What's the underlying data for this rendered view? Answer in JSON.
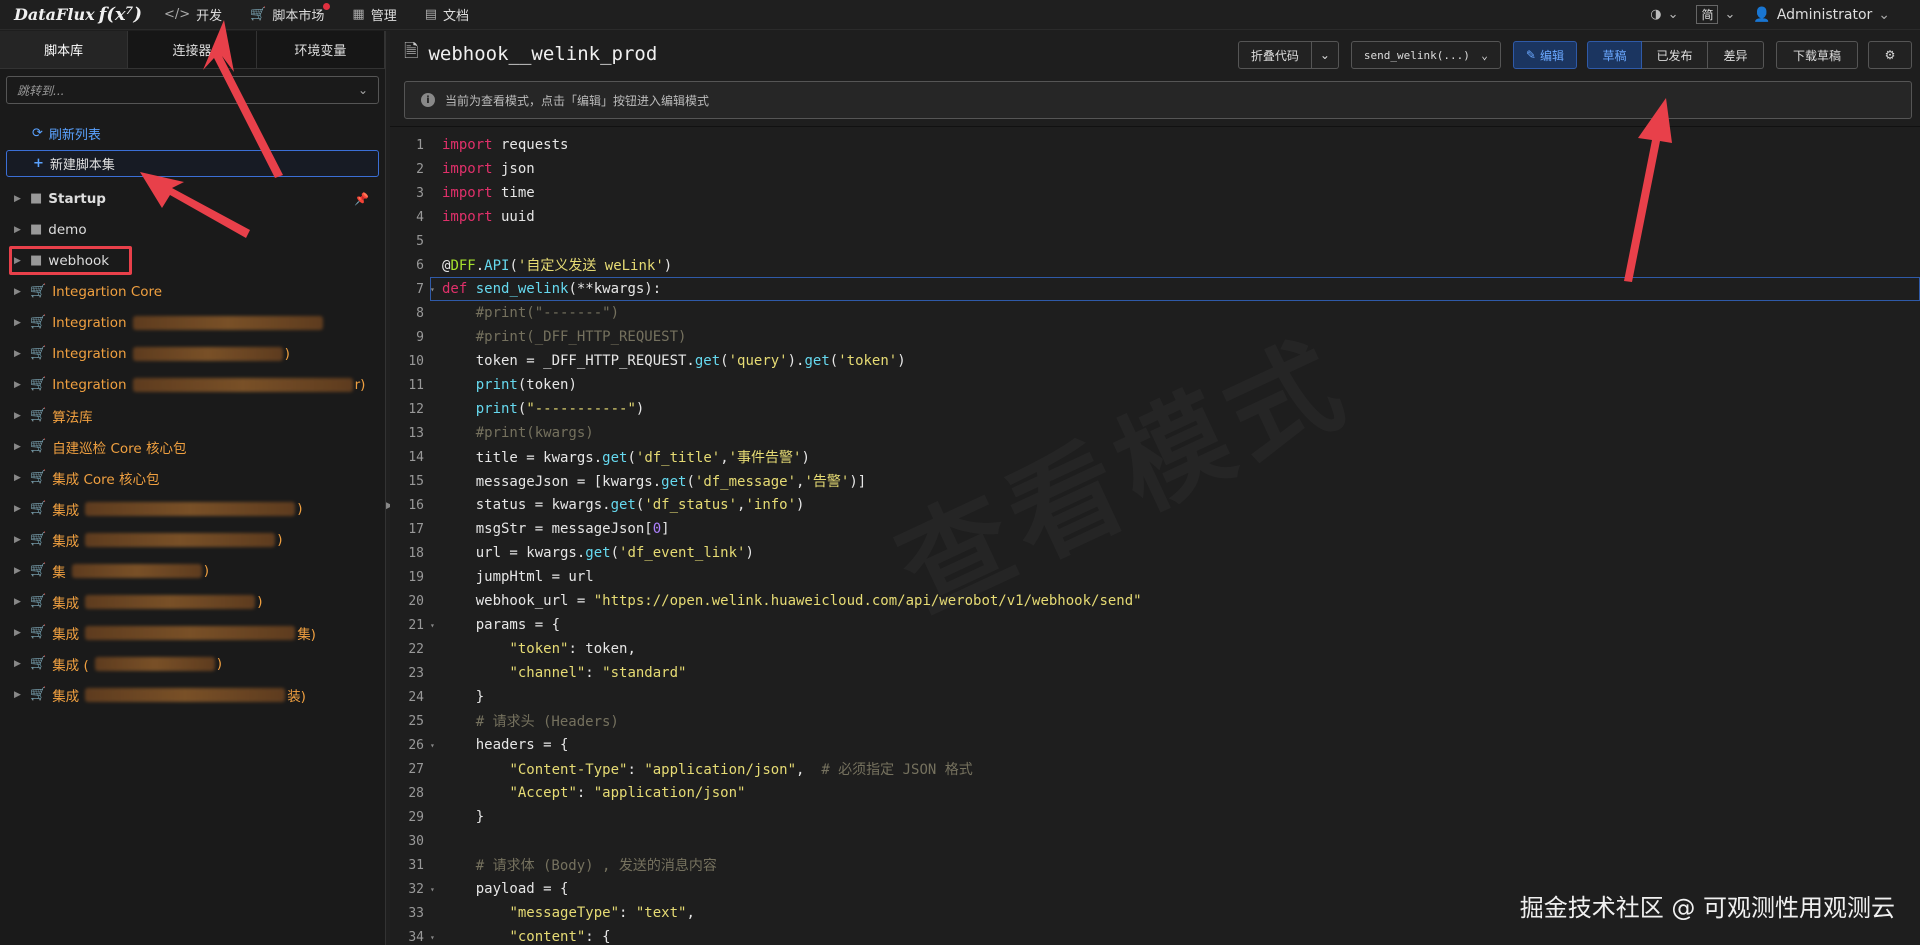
{
  "brand": {
    "name": "DataFlux",
    "fx": "f(x⁷)"
  },
  "topnav": {
    "items": [
      {
        "icon": "code-icon",
        "label": "开发"
      },
      {
        "icon": "cart-icon",
        "label": "脚本市场"
      },
      {
        "icon": "grid-icon",
        "label": "管理"
      },
      {
        "icon": "book-icon",
        "label": "文档"
      }
    ],
    "lang": "简",
    "user": "Administrator"
  },
  "sidebar": {
    "tabs": [
      "脚本库",
      "连接器",
      "环境变量"
    ],
    "jump_placeholder": "跳转到...",
    "refresh": "刷新列表",
    "new_set": "新建脚本集",
    "tree": [
      {
        "label": "Startup",
        "type": "folder",
        "style": "bold",
        "pinned": true
      },
      {
        "label": "demo",
        "type": "folder",
        "style": "grey"
      },
      {
        "label": "webhook",
        "type": "folder",
        "style": "grey"
      },
      {
        "label": "Integartion Core",
        "type": "cart",
        "style": "orange"
      },
      {
        "label": "Integration",
        "type": "cart",
        "style": "orange",
        "blur": 190
      },
      {
        "label": "Integration",
        "type": "cart",
        "style": "orange",
        "blur": 150,
        "tail": ")"
      },
      {
        "label": "Integration",
        "type": "cart",
        "style": "orange",
        "blur": 220,
        "tail": "r)"
      },
      {
        "label": "算法库",
        "type": "cart",
        "style": "orange"
      },
      {
        "label": "自建巡检 Core 核心包",
        "type": "cart",
        "style": "orange"
      },
      {
        "label": "集成 Core 核心包",
        "type": "cart",
        "style": "orange"
      },
      {
        "label": "集成",
        "type": "cart",
        "style": "orange",
        "blur": 210,
        "tail": ")"
      },
      {
        "label": "集成",
        "type": "cart",
        "style": "orange",
        "blur": 190,
        "tail": ")"
      },
      {
        "label": "集",
        "type": "cart",
        "style": "orange",
        "blur": 130,
        "tail": ")"
      },
      {
        "label": "集成",
        "type": "cart",
        "style": "orange",
        "blur": 170,
        "tail": ")"
      },
      {
        "label": "集成",
        "type": "cart",
        "style": "orange",
        "blur": 210,
        "tail": "集)"
      },
      {
        "label": "集成 (",
        "type": "cart",
        "style": "orange",
        "blur": 120,
        "tail": ")"
      },
      {
        "label": "集成",
        "type": "cart",
        "style": "orange",
        "blur": 200,
        "tail": "装)"
      }
    ]
  },
  "main": {
    "title": "webhook__welink_prod",
    "toolbar": {
      "fold": "折叠代码",
      "func_select": "send_welink(...)",
      "edit": "编辑",
      "draft": "草稿",
      "published": "已发布",
      "diff": "差异",
      "download": "下载草稿"
    },
    "notice": "当前为查看模式，点击「编辑」按钮进入编辑模式",
    "watermark": "查看模式",
    "credit": "掘金技术社区 @ 可观测性用观测云"
  },
  "code_lines": [
    [
      {
        "t": "kw",
        "v": "import"
      },
      {
        "t": "",
        "v": " requests"
      }
    ],
    [
      {
        "t": "kw",
        "v": "import"
      },
      {
        "t": "",
        "v": " json"
      }
    ],
    [
      {
        "t": "kw",
        "v": "import"
      },
      {
        "t": "",
        "v": " time"
      }
    ],
    [
      {
        "t": "kw",
        "v": "import"
      },
      {
        "t": "",
        "v": " uuid"
      }
    ],
    [],
    [
      {
        "t": "",
        "v": "@"
      },
      {
        "t": "dec",
        "v": "DFF"
      },
      {
        "t": "",
        "v": "."
      },
      {
        "t": "fn",
        "v": "API"
      },
      {
        "t": "",
        "v": "("
      },
      {
        "t": "str",
        "v": "'自定义发送 weLink'"
      },
      {
        "t": "",
        "v": ")"
      }
    ],
    [
      {
        "t": "kw",
        "v": "def"
      },
      {
        "t": "",
        "v": " "
      },
      {
        "t": "fn",
        "v": "send_welink"
      },
      {
        "t": "",
        "v": "(**kwargs):"
      }
    ],
    [
      {
        "t": "cm",
        "v": "    #print(\"-------\")"
      }
    ],
    [
      {
        "t": "cm",
        "v": "    #print(_DFF_HTTP_REQUEST)"
      }
    ],
    [
      {
        "t": "",
        "v": "    token = _DFF_HTTP_REQUEST."
      },
      {
        "t": "fn",
        "v": "get"
      },
      {
        "t": "",
        "v": "("
      },
      {
        "t": "str",
        "v": "'query'"
      },
      {
        "t": "",
        "v": ")."
      },
      {
        "t": "fn",
        "v": "get"
      },
      {
        "t": "",
        "v": "("
      },
      {
        "t": "str",
        "v": "'token'"
      },
      {
        "t": "",
        "v": ")"
      }
    ],
    [
      {
        "t": "",
        "v": "    "
      },
      {
        "t": "fn",
        "v": "print"
      },
      {
        "t": "",
        "v": "(token)"
      }
    ],
    [
      {
        "t": "",
        "v": "    "
      },
      {
        "t": "fn",
        "v": "print"
      },
      {
        "t": "",
        "v": "("
      },
      {
        "t": "str",
        "v": "\"-----------\""
      },
      {
        "t": "",
        "v": ")"
      }
    ],
    [
      {
        "t": "cm",
        "v": "    #print(kwargs)"
      }
    ],
    [
      {
        "t": "",
        "v": "    title = kwargs."
      },
      {
        "t": "fn",
        "v": "get"
      },
      {
        "t": "",
        "v": "("
      },
      {
        "t": "str",
        "v": "'df_title'"
      },
      {
        "t": "",
        "v": ","
      },
      {
        "t": "str",
        "v": "'事件告警'"
      },
      {
        "t": "",
        "v": ")"
      }
    ],
    [
      {
        "t": "",
        "v": "    messageJson = [kwargs."
      },
      {
        "t": "fn",
        "v": "get"
      },
      {
        "t": "",
        "v": "("
      },
      {
        "t": "str",
        "v": "'df_message'"
      },
      {
        "t": "",
        "v": ","
      },
      {
        "t": "str",
        "v": "'告警'"
      },
      {
        "t": "",
        "v": ")]"
      }
    ],
    [
      {
        "t": "",
        "v": "    status = kwargs."
      },
      {
        "t": "fn",
        "v": "get"
      },
      {
        "t": "",
        "v": "("
      },
      {
        "t": "str",
        "v": "'df_status'"
      },
      {
        "t": "",
        "v": ","
      },
      {
        "t": "str",
        "v": "'info'"
      },
      {
        "t": "",
        "v": ")"
      }
    ],
    [
      {
        "t": "",
        "v": "    msgStr = messageJson["
      },
      {
        "t": "num",
        "v": "0"
      },
      {
        "t": "",
        "v": "]"
      }
    ],
    [
      {
        "t": "",
        "v": "    url = kwargs."
      },
      {
        "t": "fn",
        "v": "get"
      },
      {
        "t": "",
        "v": "("
      },
      {
        "t": "str",
        "v": "'df_event_link'"
      },
      {
        "t": "",
        "v": ")"
      }
    ],
    [
      {
        "t": "",
        "v": "    jumpHtml = url"
      }
    ],
    [
      {
        "t": "",
        "v": "    webhook_url = "
      },
      {
        "t": "str",
        "v": "\"https://open.welink.huaweicloud.com/api/werobot/v1/webhook/send\""
      }
    ],
    [
      {
        "t": "",
        "v": "    params = {"
      }
    ],
    [
      {
        "t": "",
        "v": "        "
      },
      {
        "t": "str",
        "v": "\"token\""
      },
      {
        "t": "",
        "v": ": token,"
      }
    ],
    [
      {
        "t": "",
        "v": "        "
      },
      {
        "t": "str",
        "v": "\"channel\""
      },
      {
        "t": "",
        "v": ": "
      },
      {
        "t": "str",
        "v": "\"standard\""
      }
    ],
    [
      {
        "t": "",
        "v": "    }"
      }
    ],
    [
      {
        "t": "cm",
        "v": "    # 请求头 (Headers)"
      }
    ],
    [
      {
        "t": "",
        "v": "    headers = {"
      }
    ],
    [
      {
        "t": "",
        "v": "        "
      },
      {
        "t": "str",
        "v": "\"Content-Type\""
      },
      {
        "t": "",
        "v": ": "
      },
      {
        "t": "str",
        "v": "\"application/json\""
      },
      {
        "t": "",
        "v": ",  "
      },
      {
        "t": "cm",
        "v": "# 必须指定 JSON 格式"
      }
    ],
    [
      {
        "t": "",
        "v": "        "
      },
      {
        "t": "str",
        "v": "\"Accept\""
      },
      {
        "t": "",
        "v": ": "
      },
      {
        "t": "str",
        "v": "\"application/json\""
      }
    ],
    [
      {
        "t": "",
        "v": "    }"
      }
    ],
    [],
    [
      {
        "t": "cm",
        "v": "    # 请求体 (Body) , 发送的消息内容"
      }
    ],
    [
      {
        "t": "",
        "v": "    payload = {"
      }
    ],
    [
      {
        "t": "",
        "v": "        "
      },
      {
        "t": "str",
        "v": "\"messageType\""
      },
      {
        "t": "",
        "v": ": "
      },
      {
        "t": "str",
        "v": "\"text\""
      },
      {
        "t": "",
        "v": ","
      }
    ],
    [
      {
        "t": "",
        "v": "        "
      },
      {
        "t": "str",
        "v": "\"content\""
      },
      {
        "t": "",
        "v": ": {"
      }
    ]
  ],
  "fold_lines": [
    7,
    21,
    26,
    32,
    34
  ],
  "active_line": 7
}
